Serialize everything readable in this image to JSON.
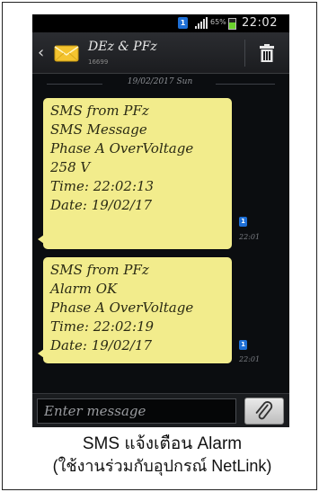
{
  "status_bar": {
    "sim_label": "1",
    "battery_percent": "65%",
    "battery_level": 0.65,
    "time": "22:02",
    "icons": [
      "sim-icon",
      "signal-icon",
      "battery-icon"
    ]
  },
  "header": {
    "contact_name": "DEz & PFz",
    "contact_number": "16699",
    "icons": [
      "back-icon",
      "envelope-icon",
      "trash-icon"
    ]
  },
  "conversation": {
    "date": "19/02/2017 Sun",
    "messages": [
      {
        "lines": [
          "SMS from PFz",
          "SMS Message",
          "Phase A OverVoltage",
          "258 V",
          "Time: 22:02:13",
          "Date: 19/02/17"
        ],
        "sim": "1",
        "time": "22:01"
      },
      {
        "lines": [
          "SMS from PFz",
          "Alarm OK",
          "Phase A OverVoltage",
          "Time: 22:02:19",
          "Date: 19/02/17"
        ],
        "sim": "1",
        "time": "22:01"
      }
    ]
  },
  "compose": {
    "placeholder": "Enter message",
    "attach_icon": "paperclip-icon"
  },
  "caption": {
    "line1": "SMS แจ้งเตือน Alarm",
    "line2": "(ใช้งานร่วมกับอุปกรณ์ NetLink)"
  },
  "colors": {
    "bubble": "#f2ec8c",
    "background": "#0b0d10",
    "sim_badge": "#1e6fd6",
    "battery": "#6ad12c"
  }
}
